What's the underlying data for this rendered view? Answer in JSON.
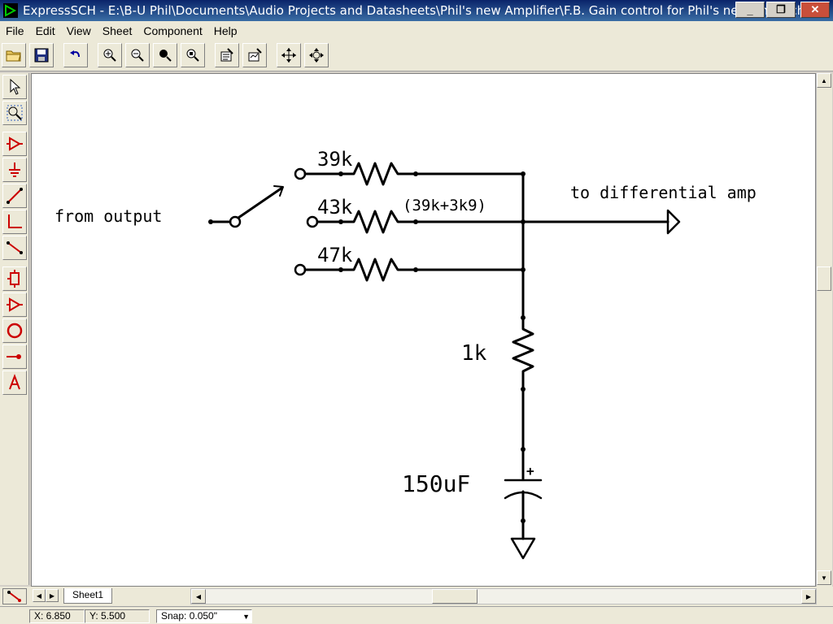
{
  "window": {
    "title": "ExpressSCH - E:\\B-U Phil\\Documents\\Audio Projects and Datasheets\\Phil's new Amplifier\\F.B. Gain control for Phil's new Amp.sch",
    "minimize": "_",
    "maximize": "❐",
    "close": "✕"
  },
  "menu": [
    "File",
    "Edit",
    "View",
    "Sheet",
    "Component",
    "Help"
  ],
  "toolbar": {
    "icons": [
      "open-folder-icon",
      "save-disk-icon",
      "undo-icon",
      "zoom-in-icon",
      "zoom-out-icon",
      "zoom-window-icon",
      "zoom-fit-icon",
      "properties-icon",
      "plot-icon",
      "pan-icon",
      "center-icon"
    ]
  },
  "left_tools": {
    "icons": [
      "select-arrow-icon",
      "zoom-select-icon",
      "place-opamp-icon",
      "place-ground-icon",
      "draw-wire-icon",
      "draw-corner-wire-icon",
      "draw-line-icon",
      "place-component-icon",
      "place-buffer-icon",
      "draw-circle-icon",
      "place-junction-icon",
      "place-text-icon"
    ]
  },
  "schematic": {
    "label_from": "from output",
    "label_to": "to differential amp",
    "r1": "39k",
    "r2": "43k",
    "r2_note": "(39k+3k9)",
    "r3": "47k",
    "r4": "1k",
    "cap": "150uF",
    "cap_polarity": "+"
  },
  "sheet_tab": "Sheet1",
  "status": {
    "x": "X: 6.850",
    "y": "Y: 5.500",
    "snap": "Snap: 0.050\""
  },
  "colors": {
    "title_bar": "#0a246a",
    "tool_red": "#cc0000",
    "canvas": "#ffffff"
  }
}
